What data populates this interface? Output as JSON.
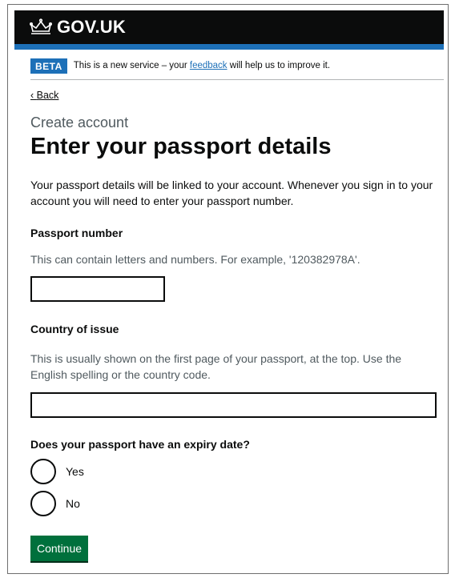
{
  "header": {
    "logo_text": "GOV.UK",
    "crown_icon": "crown-icon"
  },
  "phase_banner": {
    "tag": "BETA",
    "text_before": "This is a new service – your ",
    "link_text": "feedback",
    "text_after": " will help us to improve it."
  },
  "back_link": "Back",
  "caption": "Create account",
  "heading": "Enter your passport details",
  "intro": "Your passport details will be linked to your account. Whenever you sign in to your account you will need to enter your passport number.",
  "passport_number": {
    "label": "Passport number",
    "hint": "This can contain letters and numbers. For example, '120382978A'.",
    "value": ""
  },
  "country_of_issue": {
    "label": "Country of issue",
    "hint": "This is usually shown on the first page of your passport, at the top. Use the English spelling or the country code.",
    "value": ""
  },
  "expiry": {
    "legend": "Does your passport have an expiry date?",
    "options": [
      "Yes",
      "No"
    ]
  },
  "continue_label": "Continue",
  "colors": {
    "header": "#0b0c0c",
    "brand_blue": "#1d70b8",
    "button_green": "#00703c",
    "hint_grey": "#505a5f"
  }
}
